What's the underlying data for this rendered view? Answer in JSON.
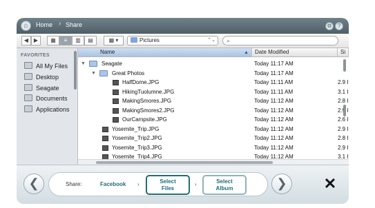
{
  "window": {
    "breadcrumb": {
      "home": "Home",
      "separator": "›",
      "current": "Share"
    },
    "title_icons": {
      "settings": "⚙",
      "help": "?"
    }
  },
  "toolbar": {
    "back": "◀",
    "forward": "▶",
    "views": [
      "▦",
      "≡",
      "▥",
      "▤"
    ],
    "arrange": "▦ ▾",
    "location": "Pictures",
    "location_arrows": "⌃⌄",
    "search_icon": "⌕"
  },
  "sidebar": {
    "title": "FAVORITES",
    "items": [
      {
        "label": "All My Files",
        "icon": "files-icon"
      },
      {
        "label": "Desktop",
        "icon": "desktop-icon"
      },
      {
        "label": "Seagate",
        "icon": "home-icon"
      },
      {
        "label": "Documents",
        "icon": "documents-icon"
      },
      {
        "label": "Applications",
        "icon": "applications-icon"
      }
    ]
  },
  "columns": {
    "name": "Name",
    "date": "Date Modified",
    "size": "Si"
  },
  "sort_arrow": "▲",
  "rows": [
    {
      "type": "folder",
      "level": 0,
      "name": "Seagate",
      "date": "Today 11:17 AM",
      "size": ""
    },
    {
      "type": "folder",
      "level": 1,
      "name": "Great Photos",
      "date": "Today 11:17 AM",
      "size": ""
    },
    {
      "type": "file",
      "level": 2,
      "name": "HalfDome.JPG",
      "date": "Today 11:11 AM",
      "size": "2.9 I"
    },
    {
      "type": "file",
      "level": 2,
      "name": "HikingTuolumne.JPG",
      "date": "Today 11:11 AM",
      "size": "3.1 I"
    },
    {
      "type": "file",
      "level": 2,
      "name": "MakingSmores.JPG",
      "date": "Today 11:12 AM",
      "size": "2.8 I"
    },
    {
      "type": "file",
      "level": 2,
      "name": "MakingSmores2.JPG",
      "date": "Today 11:12 AM",
      "size": "2.9 I"
    },
    {
      "type": "file",
      "level": 2,
      "name": "OurCampsite.JPG",
      "date": "Today 11:12 AM",
      "size": "2.6 I"
    },
    {
      "type": "file",
      "level": 1,
      "name": "Yosemite_Trip.JPG",
      "date": "Today 11:12 AM",
      "size": "2.9 I"
    },
    {
      "type": "file",
      "level": 1,
      "name": "Yosemite_Trip2.JPG",
      "date": "Today 11:12 AM",
      "size": "2.8 I"
    },
    {
      "type": "file",
      "level": 1,
      "name": "Yosemite_Trip3.JPG",
      "date": "Today 11:12 AM",
      "size": "2.9 I"
    },
    {
      "type": "file",
      "level": 1,
      "name": "Yosemite_Trip4.JPG",
      "date": "Today 11:12 AM",
      "size": "3.1 I"
    }
  ],
  "actionbar": {
    "back": "❮",
    "forward": "❯",
    "close": "✕",
    "share_label": "Share:",
    "facebook_label": "Facebook",
    "step_arrow": "›",
    "select_files": [
      "Select",
      "Files"
    ],
    "select_album": [
      "Select",
      "Album"
    ]
  },
  "colors": {
    "accent": "#1f6d79",
    "titlebar": "#4f5f68",
    "selected_column": "#a9c3e2"
  }
}
